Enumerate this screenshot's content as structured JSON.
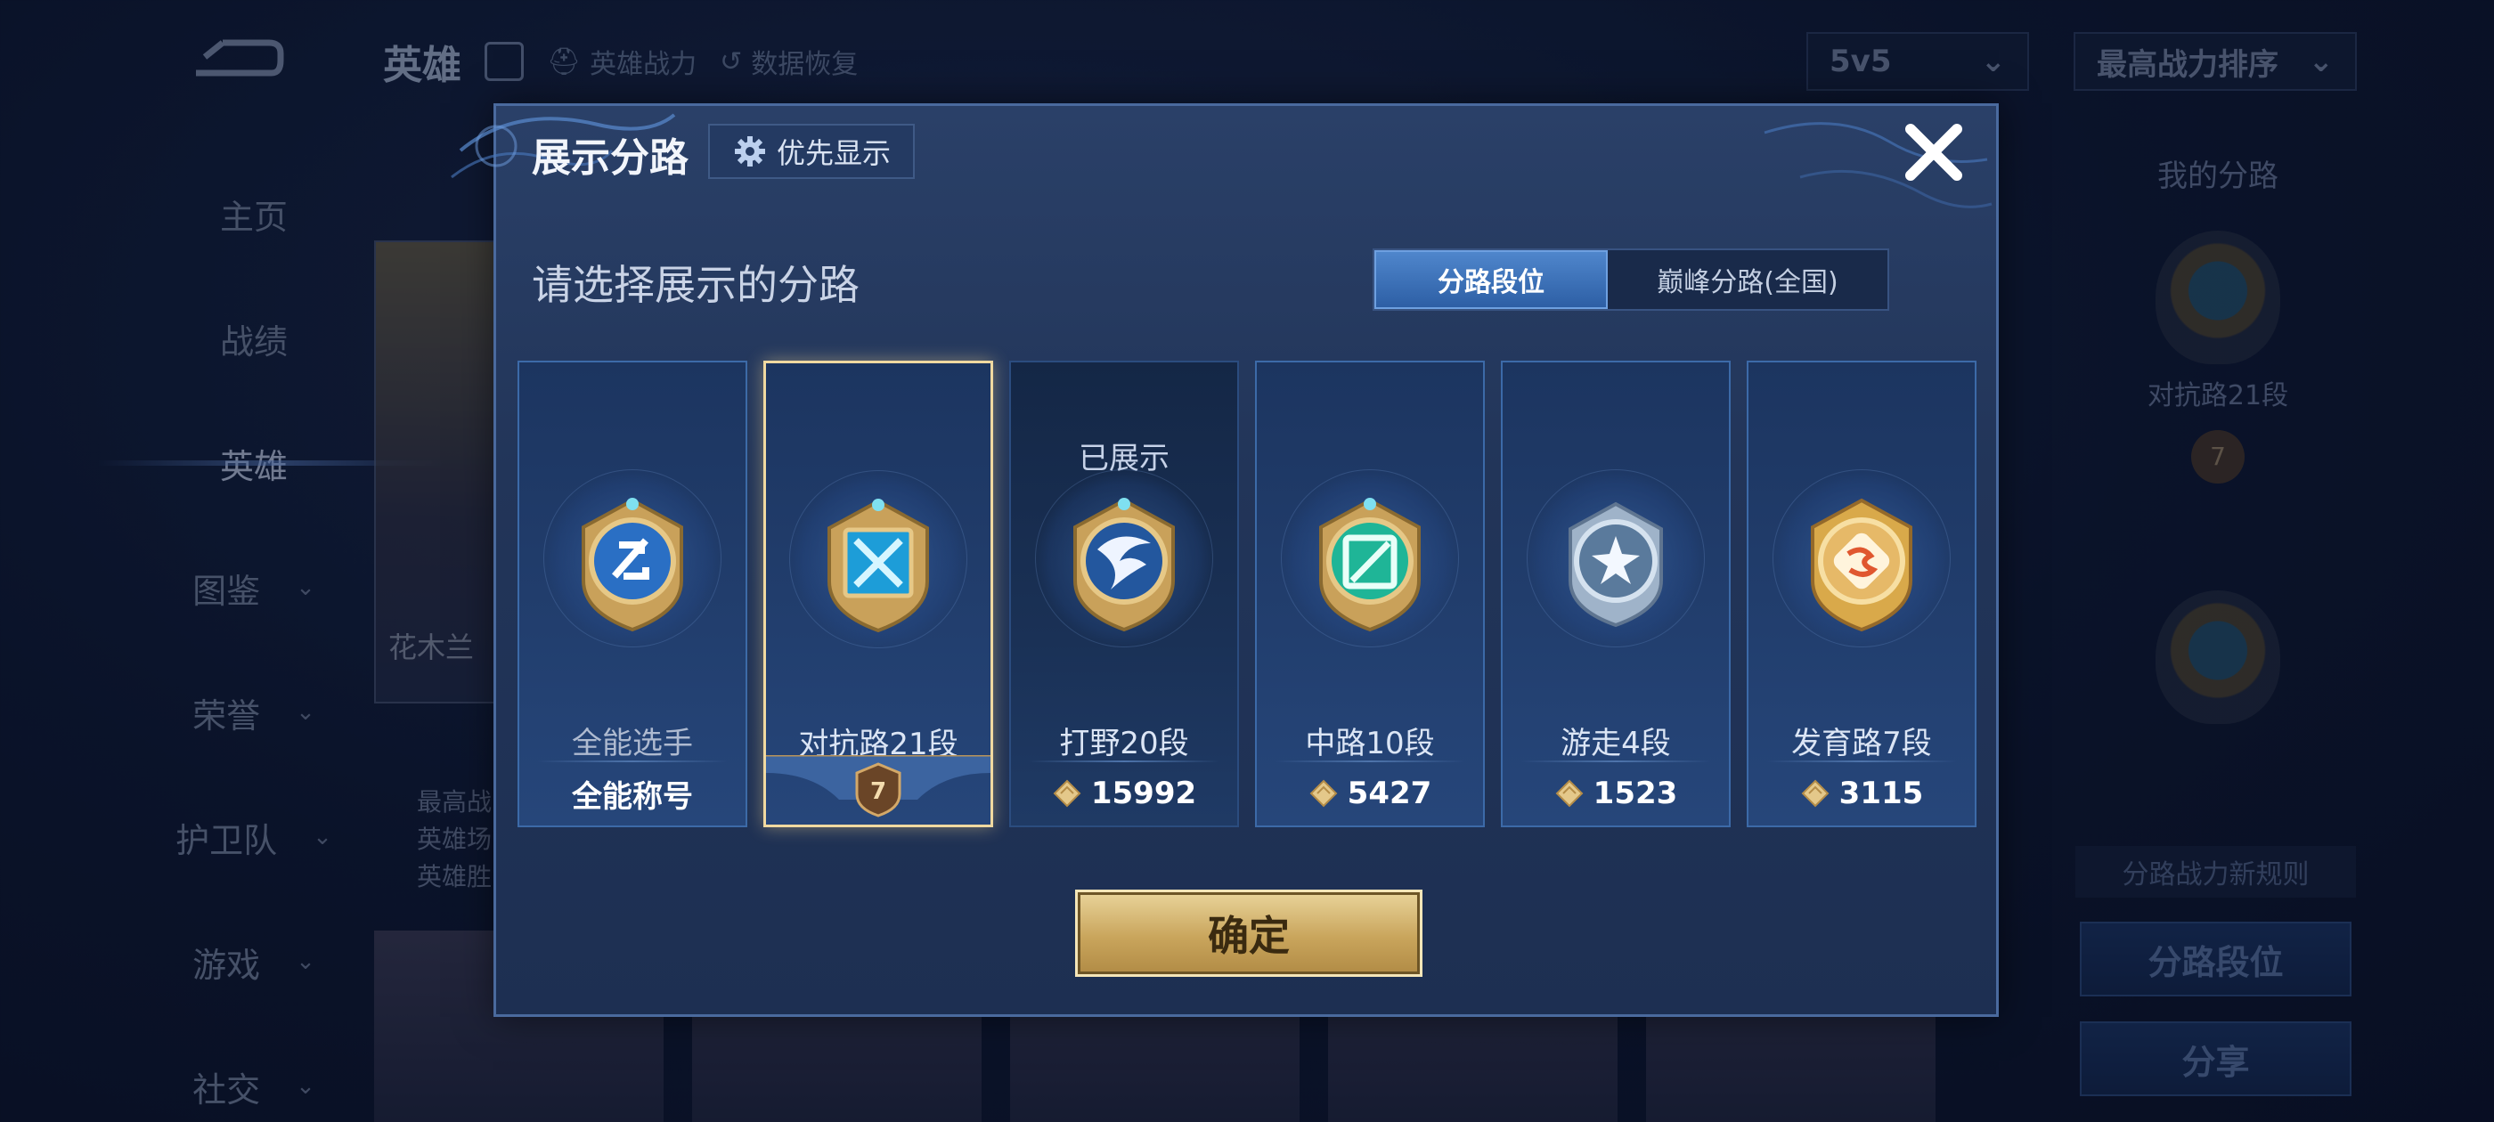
{
  "background": {
    "header": {
      "title": "英雄",
      "hero_power": "英雄战力",
      "data_restore": "数据恢复",
      "mode_select": "5v5",
      "sort_select": "最高战力排序"
    },
    "sidebar": {
      "items": [
        {
          "label": "主页"
        },
        {
          "label": "战绩"
        },
        {
          "label": "英雄"
        },
        {
          "label": "图鉴"
        },
        {
          "label": "荣誉"
        },
        {
          "label": "护卫队"
        },
        {
          "label": "游戏"
        },
        {
          "label": "社交"
        }
      ],
      "active": "英雄"
    },
    "hero_card": {
      "name": "花木兰",
      "line1": "最高战",
      "line2": "英雄场",
      "line3": "英雄胜"
    },
    "right_panel": {
      "my_lane_label": "我的分路",
      "current_lane": "对抗路21段",
      "current_rank_badge": "7",
      "rules_note": "分路战力新规则",
      "lane_rank_button": "分路段位",
      "share_button": "分享"
    }
  },
  "modal": {
    "title": "展示分路",
    "priority_button": "优先显示",
    "prompt": "请选择展示的分路",
    "toggle": {
      "options": [
        "分路段位",
        "巅峰分路(全国)"
      ],
      "selected": "分路段位"
    },
    "lanes": [
      {
        "name": "全能选手",
        "footer": "全能称号",
        "type": "title",
        "shown": false,
        "selected": false,
        "emblem": "allround-emblem"
      },
      {
        "name": "对抗路21段",
        "rank_badge": "7",
        "type": "rank",
        "shown": false,
        "selected": true,
        "emblem": "clash-lane-emblem"
      },
      {
        "name": "打野20段",
        "shown_label": "已展示",
        "score": "15992",
        "type": "score",
        "shown": true,
        "selected": false,
        "emblem": "jungle-emblem"
      },
      {
        "name": "中路10段",
        "score": "5427",
        "type": "score",
        "shown": false,
        "selected": false,
        "emblem": "mid-lane-emblem"
      },
      {
        "name": "游走4段",
        "score": "1523",
        "type": "score",
        "shown": false,
        "selected": false,
        "emblem": "roam-emblem"
      },
      {
        "name": "发育路7段",
        "score": "3115",
        "type": "score",
        "shown": false,
        "selected": false,
        "emblem": "farm-lane-emblem"
      }
    ],
    "confirm_button": "确定"
  },
  "colors": {
    "accent_gold": "#e9d49a",
    "selected_border": "#f0d9a0",
    "toggle_active": "#3a71b9",
    "modal_bg": "#223559"
  }
}
